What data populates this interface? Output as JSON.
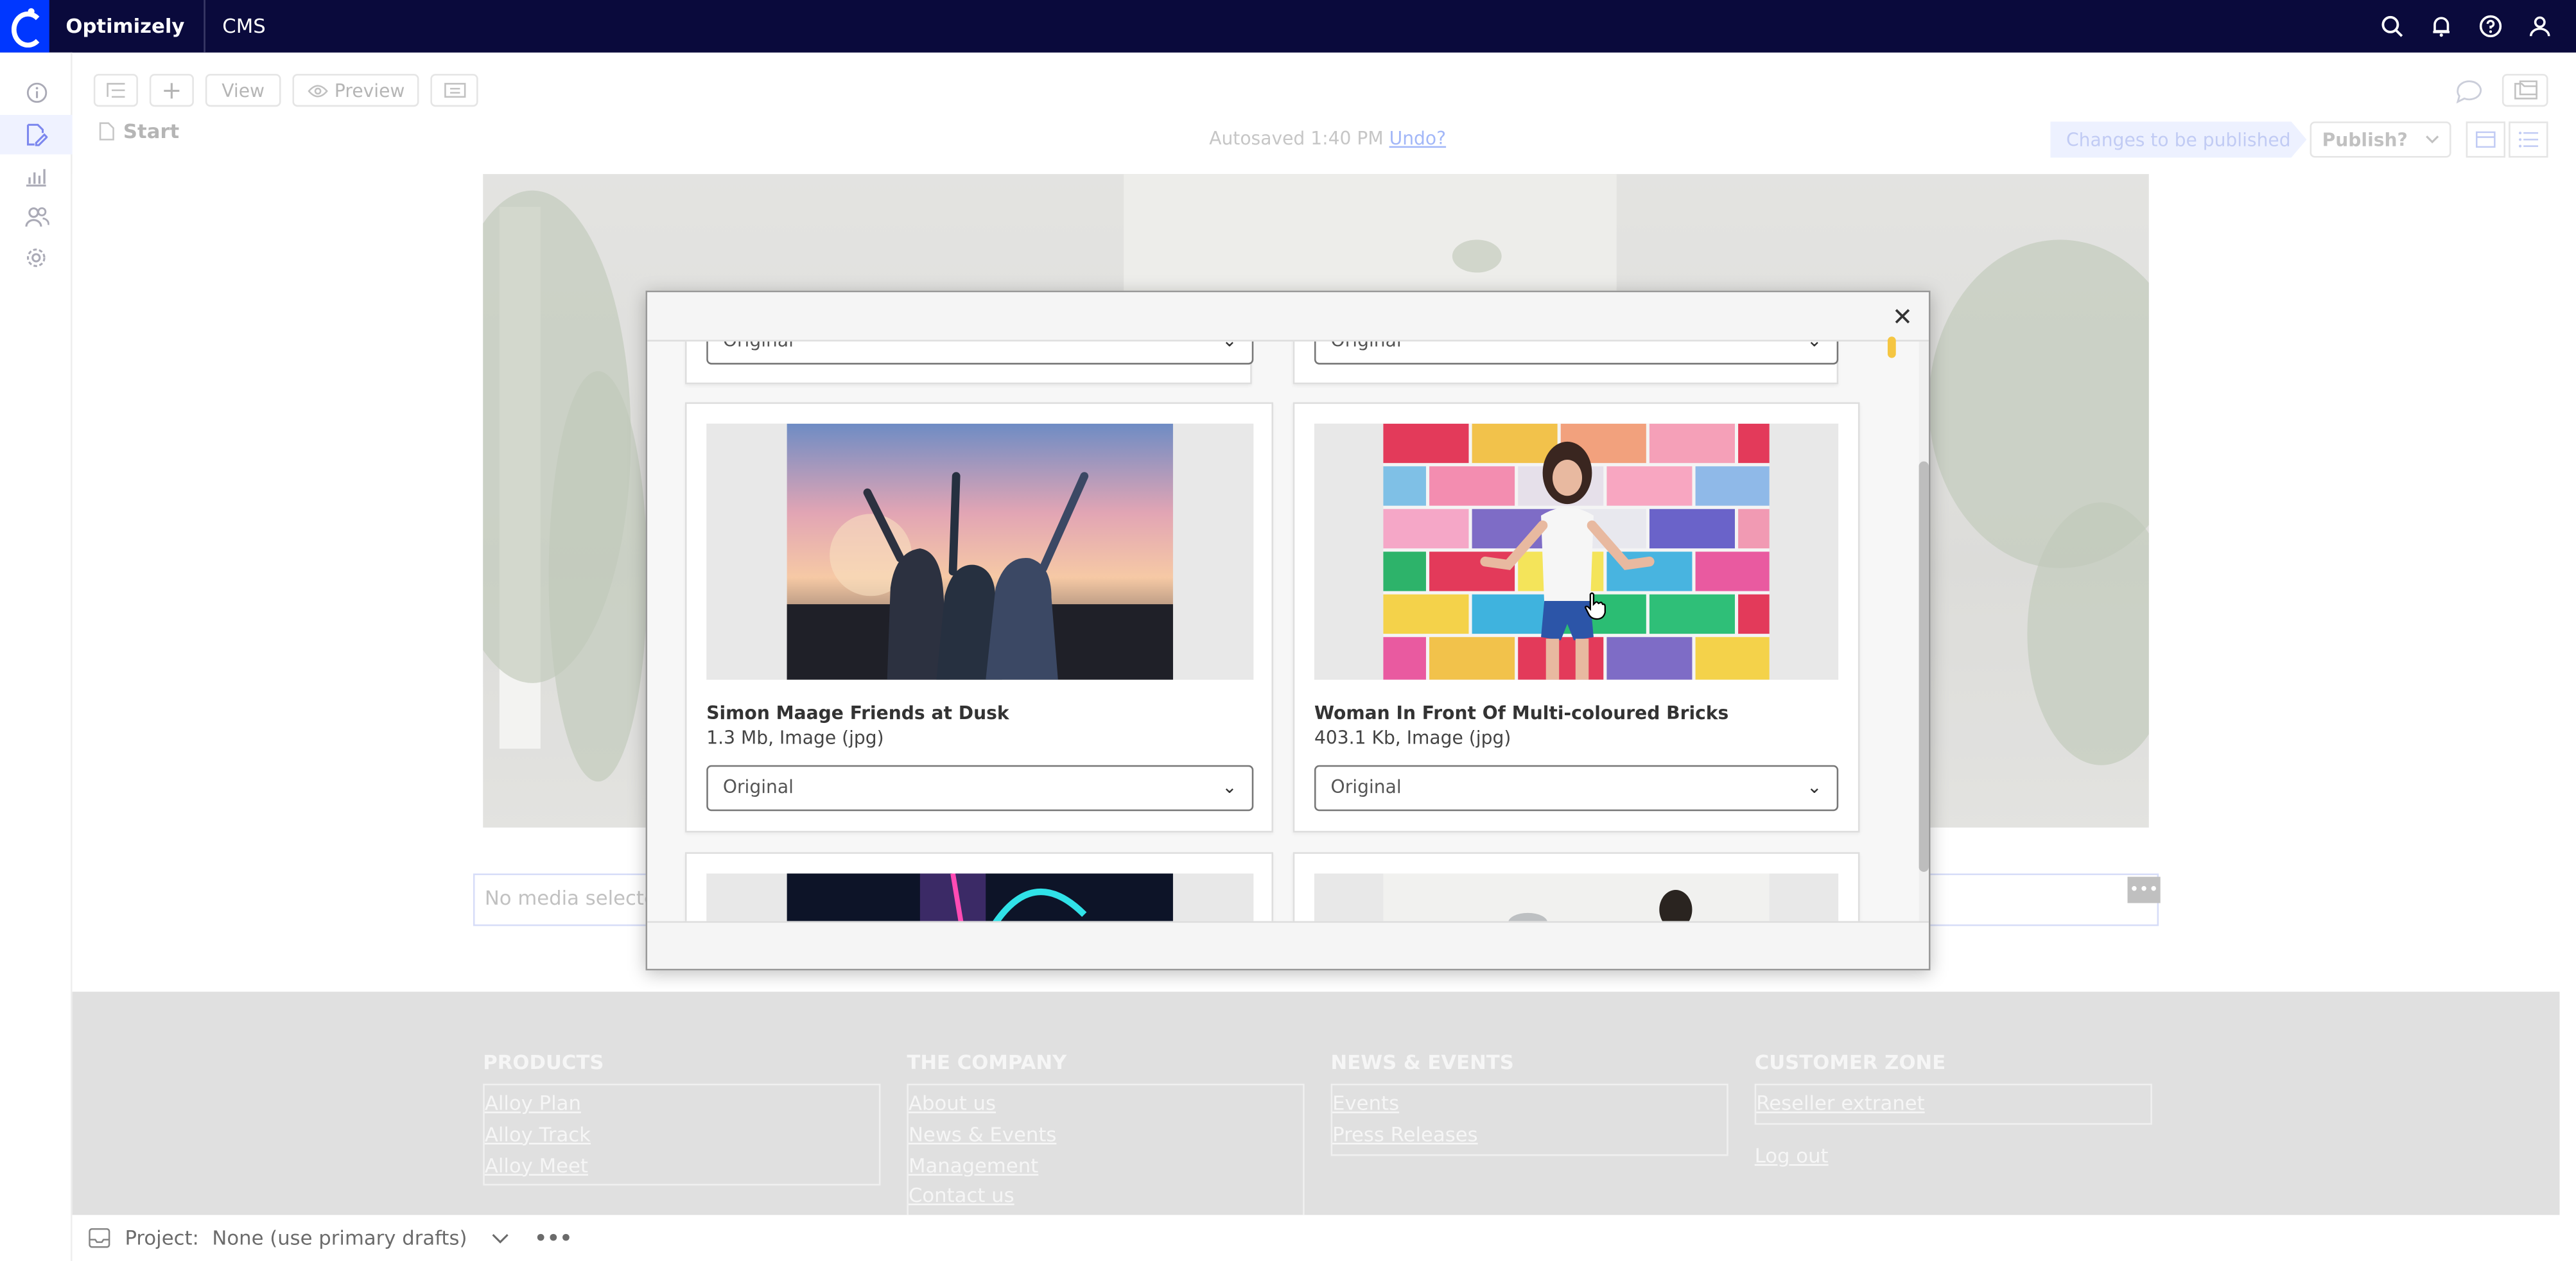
{
  "header": {
    "brand": "Optimizely",
    "product": "CMS",
    "icons": [
      "search-icon",
      "bell-icon",
      "help-icon",
      "user-icon"
    ]
  },
  "rail": {
    "items": [
      {
        "icon": "info-icon",
        "active": false
      },
      {
        "icon": "edit-icon",
        "active": true
      },
      {
        "icon": "analytics-icon",
        "active": false
      },
      {
        "icon": "users-icon",
        "active": false
      },
      {
        "icon": "gear-icon",
        "active": false
      }
    ]
  },
  "toolbar": {
    "view_label": "View",
    "preview_label": "Preview",
    "breadcrumb": "Start",
    "autosave_text": "Autosaved 1:40 PM",
    "undo_label": "Undo?",
    "changes_label": "Changes to be published",
    "publish_label": "Publish?"
  },
  "page": {
    "no_media": "No media selected",
    "more_label": "•••"
  },
  "footer": {
    "columns": [
      {
        "title": "PRODUCTS",
        "links": [
          "Alloy Plan",
          "Alloy Track",
          "Alloy Meet"
        ]
      },
      {
        "title": "THE COMPANY",
        "links": [
          "About us",
          "News & Events",
          "Management",
          "Contact us"
        ]
      },
      {
        "title": "NEWS & EVENTS",
        "links": [
          "Events",
          "Press Releases"
        ]
      },
      {
        "title": "CUSTOMER ZONE",
        "links": [
          "Reseller extranet"
        ],
        "extra_link": "Log out"
      }
    ]
  },
  "project_bar": {
    "label": "Project:",
    "value": "None (use primary drafts)",
    "more_label": "•••"
  },
  "dialog": {
    "close_icon": "close-icon",
    "top_select_value_left": "Original",
    "top_select_value_right": "Original",
    "cards": [
      {
        "title": "Simon Maage Friends at Dusk",
        "meta": "1.3 Mb, Image (jpg)",
        "select_value": "Original"
      },
      {
        "title": "Woman In Front Of Multi-coloured Bricks",
        "meta": "403.1 Kb, Image (jpg)",
        "select_value": "Original"
      }
    ]
  },
  "colors": {
    "topbar": "#0a0a3c",
    "brand_blue": "#0037ff",
    "accent": "#4b5ae8",
    "footer_bg": "#d4d4d4"
  }
}
